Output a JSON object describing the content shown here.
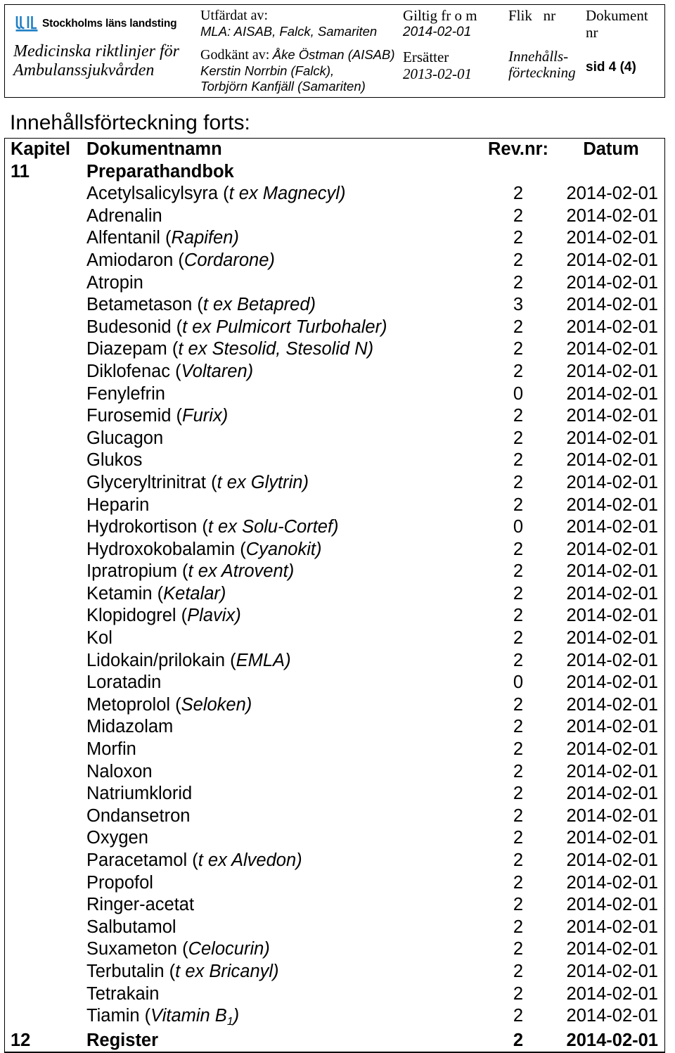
{
  "header": {
    "logo": {
      "icon": "stockholms-lans-landsting-logo",
      "wordmark": "Stockholms läns landsting",
      "color": "#1f7fc4"
    },
    "doc_title_line1": "Medicinska riktlinjer för",
    "doc_title_line2": "Ambulanssjukvården",
    "issuer": {
      "label": "Utfärdat av:",
      "value": "MLA: AISAB, Falck, Samariten",
      "approved_label": "Godkänt av:",
      "approved_value": "Åke Östman (AISAB)",
      "approved_value_line2": "Kerstin Norrbin (Falck),",
      "approved_value_line3": "Torbjörn Kanfjäll (Samariten)"
    },
    "validity": {
      "valid_label": "Giltig fr o m",
      "valid_value": "2014-02-01",
      "replaces_label": "Ersätter",
      "replaces_value": "2013-02-01"
    },
    "flik": {
      "label_a": "Flik",
      "label_b": "nr",
      "value_line1": "Innehålls-",
      "value_line2": "förteckning"
    },
    "document": {
      "label_line1": "Dokument",
      "label_line2": "nr",
      "page": "sid 4 (4)"
    }
  },
  "page_heading": "Innehållsförteckning forts:",
  "toc": {
    "columns": {
      "chapter": "Kapitel",
      "name": "Dokumentnamn",
      "revision": "Rev.nr:",
      "date": "Datum"
    },
    "rows": [
      {
        "type": "chapter",
        "chapter": "11",
        "name": "Preparathandbok",
        "rev": "",
        "date": ""
      },
      {
        "type": "item",
        "chapter": "",
        "name": "Acetylsalicylsyra (",
        "name_i": "t ex Magnecyl)",
        "rev": "2",
        "date": "2014-02-01"
      },
      {
        "type": "item",
        "chapter": "",
        "name": "Adrenalin",
        "name_i": "",
        "rev": "2",
        "date": "2014-02-01"
      },
      {
        "type": "item",
        "chapter": "",
        "name": "Alfentanil (",
        "name_i": "Rapifen)",
        "rev": "2",
        "date": "2014-02-01"
      },
      {
        "type": "item",
        "chapter": "",
        "name": "Amiodaron (",
        "name_i": "Cordarone)",
        "rev": "2",
        "date": "2014-02-01"
      },
      {
        "type": "item",
        "chapter": "",
        "name": "Atropin",
        "name_i": "",
        "rev": "2",
        "date": "2014-02-01"
      },
      {
        "type": "item",
        "chapter": "",
        "name": "Betametason (",
        "name_i": "t ex Betapred)",
        "rev": "3",
        "date": "2014-02-01"
      },
      {
        "type": "item",
        "chapter": "",
        "name": "Budesonid (",
        "name_i": "t ex Pulmicort Turbohaler)",
        "rev": "2",
        "date": "2014-02-01"
      },
      {
        "type": "item",
        "chapter": "",
        "name": "Diazepam (",
        "name_i": "t ex Stesolid, Stesolid N)",
        "rev": "2",
        "date": "2014-02-01"
      },
      {
        "type": "item",
        "chapter": "",
        "name": "Diklofenac (",
        "name_i": "Voltaren)",
        "rev": "2",
        "date": "2014-02-01"
      },
      {
        "type": "item",
        "chapter": "",
        "name": "Fenylefrin",
        "name_i": "",
        "rev": "0",
        "date": "2014-02-01"
      },
      {
        "type": "item",
        "chapter": "",
        "name": "Furosemid (",
        "name_i": "Furix)",
        "rev": "2",
        "date": "2014-02-01"
      },
      {
        "type": "item",
        "chapter": "",
        "name": "Glucagon",
        "name_i": "",
        "rev": "2",
        "date": "2014-02-01"
      },
      {
        "type": "item",
        "chapter": "",
        "name": "Glukos",
        "name_i": "",
        "rev": "2",
        "date": "2014-02-01"
      },
      {
        "type": "item",
        "chapter": "",
        "name": "Glyceryltrinitrat (",
        "name_i": "t ex Glytrin)",
        "rev": "2",
        "date": "2014-02-01"
      },
      {
        "type": "item",
        "chapter": "",
        "name": "Heparin",
        "name_i": "",
        "rev": "2",
        "date": "2014-02-01"
      },
      {
        "type": "item",
        "chapter": "",
        "name": "Hydrokortison (",
        "name_i": "t ex Solu-Cortef)",
        "rev": "0",
        "date": "2014-02-01"
      },
      {
        "type": "item",
        "chapter": "",
        "name": "Hydroxokobalamin (",
        "name_i": "Cyanokit)",
        "rev": "2",
        "date": "2014-02-01"
      },
      {
        "type": "item",
        "chapter": "",
        "name": "Ipratropium (",
        "name_i": "t ex Atrovent)",
        "rev": "2",
        "date": "2014-02-01"
      },
      {
        "type": "item",
        "chapter": "",
        "name": "Ketamin (",
        "name_i": "Ketalar)",
        "rev": "2",
        "date": "2014-02-01"
      },
      {
        "type": "item",
        "chapter": "",
        "name": "Klopidogrel (",
        "name_i": "Plavix)",
        "rev": "2",
        "date": "2014-02-01"
      },
      {
        "type": "item",
        "chapter": "",
        "name": "Kol",
        "name_i": "",
        "rev": "2",
        "date": "2014-02-01"
      },
      {
        "type": "item",
        "chapter": "",
        "name": "Lidokain/prilokain (",
        "name_i": "EMLA)",
        "rev": "2",
        "date": "2014-02-01"
      },
      {
        "type": "item",
        "chapter": "",
        "name": "Loratadin",
        "name_i": "",
        "rev": "0",
        "date": "2014-02-01"
      },
      {
        "type": "item",
        "chapter": "",
        "name": "Metoprolol (",
        "name_i": "Seloken)",
        "rev": "2",
        "date": "2014-02-01"
      },
      {
        "type": "item",
        "chapter": "",
        "name": "Midazolam",
        "name_i": "",
        "rev": "2",
        "date": "2014-02-01"
      },
      {
        "type": "item",
        "chapter": "",
        "name": "Morfin",
        "name_i": "",
        "rev": "2",
        "date": "2014-02-01"
      },
      {
        "type": "item",
        "chapter": "",
        "name": "Naloxon",
        "name_i": "",
        "rev": "2",
        "date": "2014-02-01"
      },
      {
        "type": "item",
        "chapter": "",
        "name": "Natriumklorid",
        "name_i": "",
        "rev": "2",
        "date": "2014-02-01"
      },
      {
        "type": "item",
        "chapter": "",
        "name": "Ondansetron",
        "name_i": "",
        "rev": "2",
        "date": "2014-02-01"
      },
      {
        "type": "item",
        "chapter": "",
        "name": "Oxygen",
        "name_i": "",
        "rev": "2",
        "date": "2014-02-01"
      },
      {
        "type": "item",
        "chapter": "",
        "name": "Paracetamol (",
        "name_i": "t ex Alvedon)",
        "rev": "2",
        "date": "2014-02-01"
      },
      {
        "type": "item",
        "chapter": "",
        "name": "Propofol",
        "name_i": "",
        "rev": "2",
        "date": "2014-02-01"
      },
      {
        "type": "item",
        "chapter": "",
        "name": "Ringer-acetat",
        "name_i": "",
        "rev": "2",
        "date": "2014-02-01"
      },
      {
        "type": "item",
        "chapter": "",
        "name": "Salbutamol",
        "name_i": "",
        "rev": "2",
        "date": "2014-02-01"
      },
      {
        "type": "item",
        "chapter": "",
        "name": "Suxameton (",
        "name_i": "Celocurin)",
        "rev": "2",
        "date": "2014-02-01"
      },
      {
        "type": "item",
        "chapter": "",
        "name": "Terbutalin (",
        "name_i": "t ex Bricanyl)",
        "rev": "2",
        "date": "2014-02-01"
      },
      {
        "type": "item",
        "chapter": "",
        "name": "Tetrakain",
        "name_i": "",
        "rev": "2",
        "date": "2014-02-01"
      },
      {
        "type": "item",
        "chapter": "",
        "name": "Tiamin (",
        "name_i": "Vitamin B",
        "name_sub": "1",
        "name_i_tail": ")",
        "rev": "2",
        "date": "2014-02-01"
      },
      {
        "type": "chapter",
        "chapter": "12",
        "name": "Register",
        "rev": "2",
        "date": "2014-02-01"
      }
    ]
  }
}
